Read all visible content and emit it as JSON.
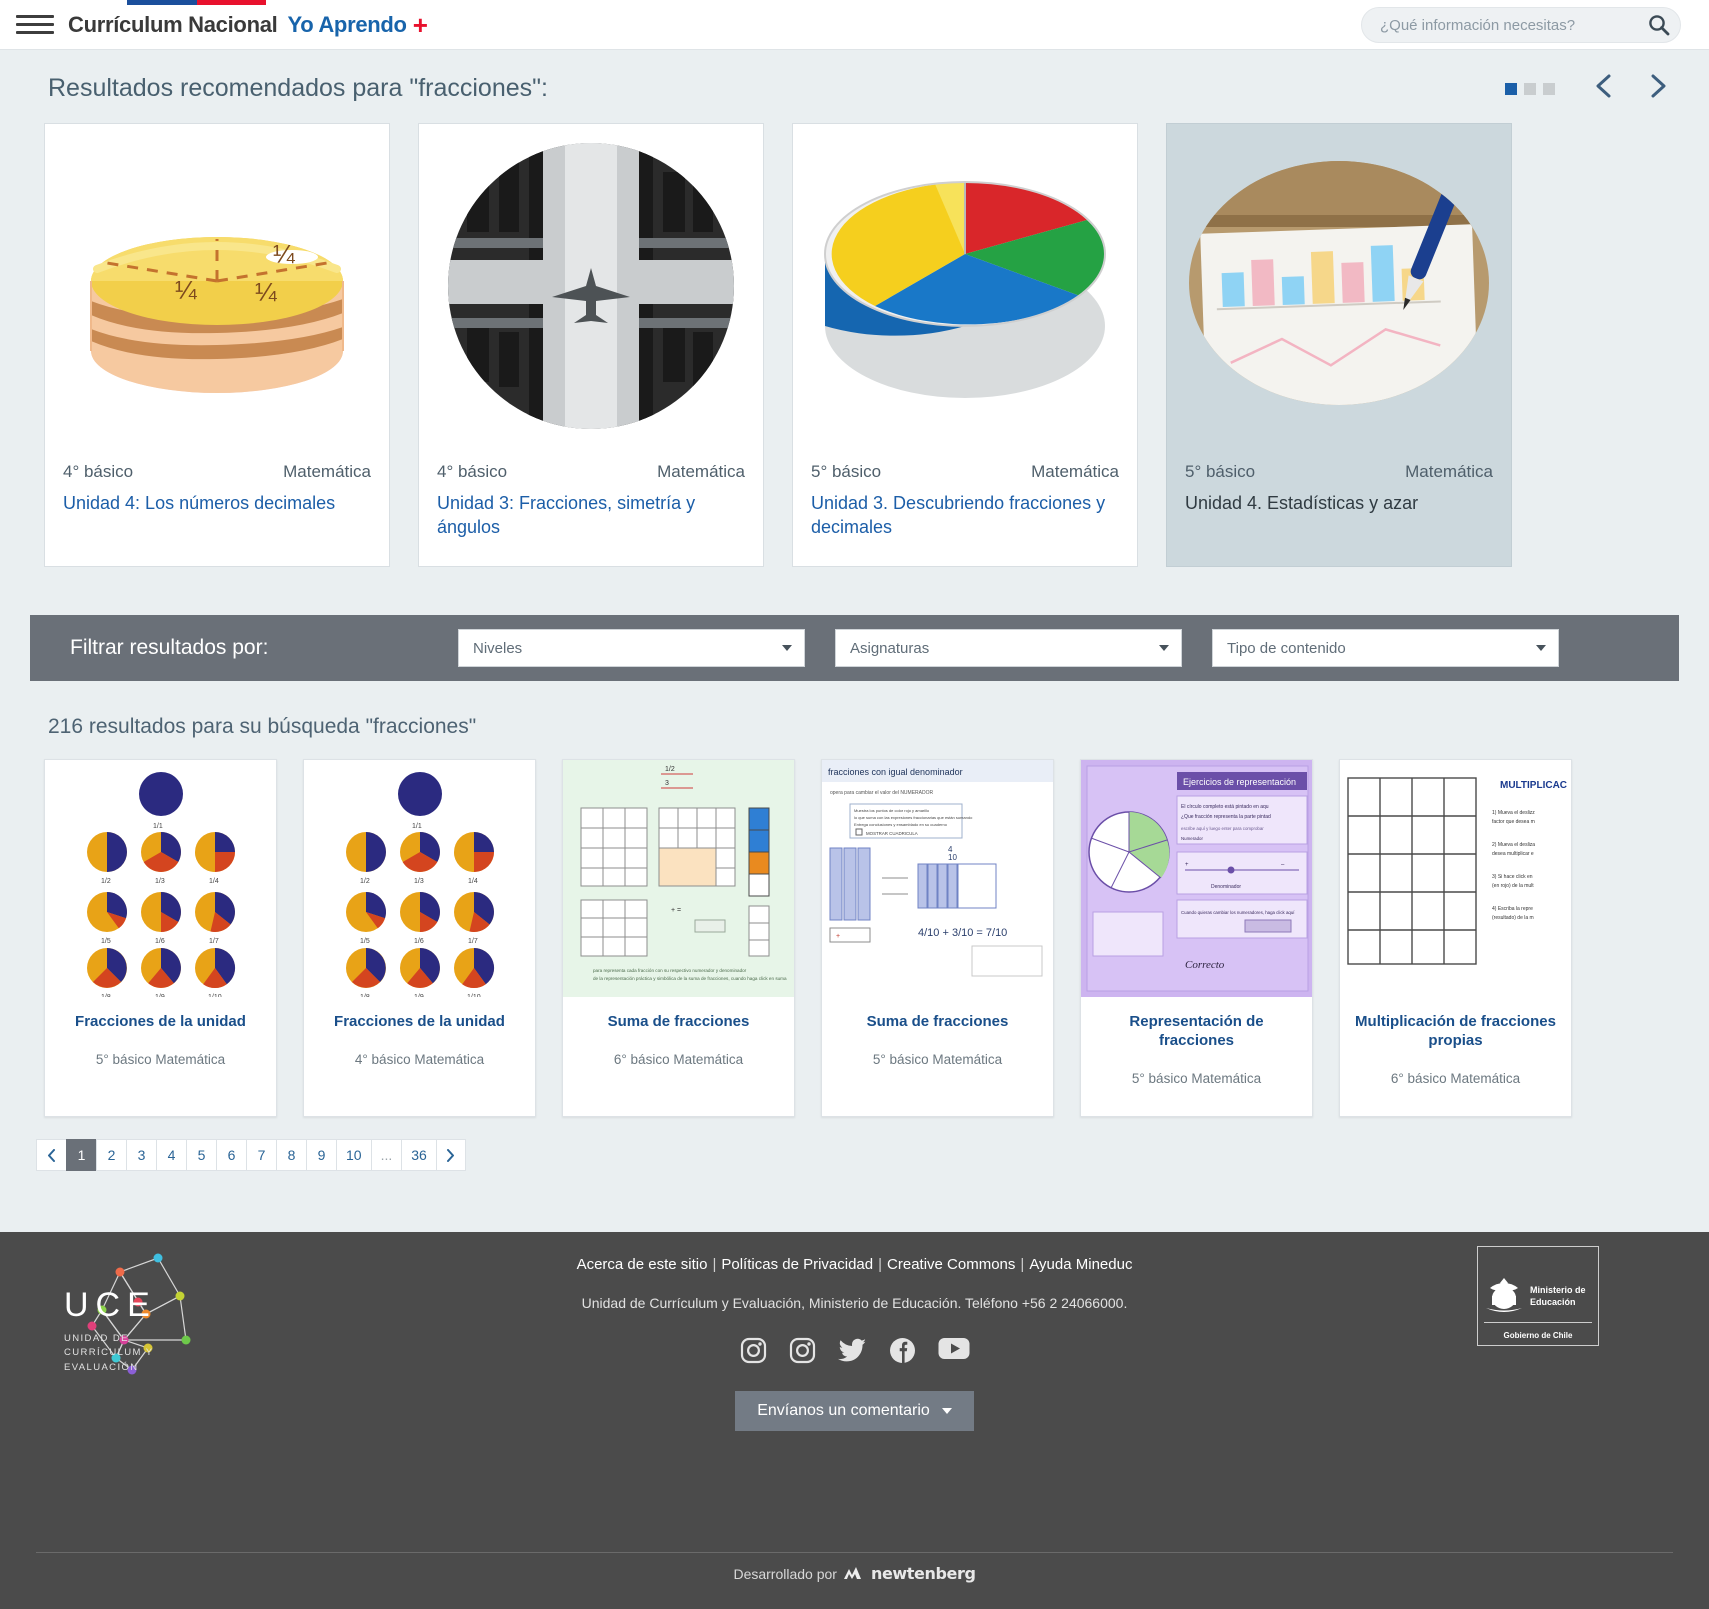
{
  "header": {
    "menu_icon": "hamburger-menu-icon",
    "brand": "Currículum Nacional",
    "brand_sub": "Yo Aprendo",
    "brand_plus": "+",
    "flag_colors": [
      "#ffffff",
      "#1b4f9c",
      "#e8112d"
    ],
    "search": {
      "placeholder": "¿Qué información necesitas?",
      "value": "",
      "icon": "search-icon"
    }
  },
  "recommended": {
    "title": "Resultados recomendados para \"fracciones\":",
    "dots": [
      "on",
      "off",
      "off"
    ],
    "prev_icon": "chevron-left-icon",
    "next_icon": "chevron-right-icon",
    "cards": [
      {
        "level": "4° básico",
        "subject": "Matemática",
        "name": "Unidad 4: Los números decimales",
        "thumb": "cake-fractions-illustration",
        "active": false
      },
      {
        "level": "4° básico",
        "subject": "Matemática",
        "name": "Unidad 3: Fracciones, simetría y ángulos",
        "thumb": "airplane-symmetry-photo",
        "active": false
      },
      {
        "level": "5° básico",
        "subject": "Matemática",
        "name": "Unidad 3. Descubriendo fracciones y decimales",
        "thumb": "colored-pie-blocks-photo",
        "active": false
      },
      {
        "level": "5° básico",
        "subject": "Matemática",
        "name": "Unidad 4. Estadísticas y azar",
        "thumb": "charts-and-pen-photo",
        "active": true
      }
    ]
  },
  "filters": {
    "label": "Filtrar resultados por:",
    "selects": [
      {
        "name": "niveles",
        "value": "Niveles"
      },
      {
        "name": "asignaturas",
        "value": "Asignaturas"
      },
      {
        "name": "tipo-de-contenido",
        "value": "Tipo de contenido"
      }
    ]
  },
  "results": {
    "count_text": "216 resultados para su búsqueda \"fracciones\"",
    "cards": [
      {
        "title": "Fracciones de la unidad",
        "meta": "5° básico Matemática",
        "thumb": "fraction-circles-grid"
      },
      {
        "title": "Fracciones de la unidad",
        "meta": "4° básico Matemática",
        "thumb": "fraction-circles-grid"
      },
      {
        "title": "Suma de fracciones",
        "meta": "6° básico Matemática",
        "thumb": "green-worksheet-grid"
      },
      {
        "title": "Suma de fracciones",
        "meta": "5° básico Matemática",
        "thumb": "denominator-worksheet"
      },
      {
        "title": "Representación de fracciones",
        "meta": "5° básico Matemática",
        "thumb": "purple-exercise-screen"
      },
      {
        "title": "Multiplicación de fracciones propias",
        "meta": "6° básico Matemática",
        "thumb": "multiplication-worksheet"
      }
    ]
  },
  "pagination": {
    "prev_icon": "chevron-left-icon",
    "next_icon": "chevron-right-icon",
    "pages": [
      "1",
      "2",
      "3",
      "4",
      "5",
      "6",
      "7",
      "8",
      "9",
      "10",
      "...",
      "36"
    ],
    "active": "1"
  },
  "footer": {
    "uce_word": "UCE",
    "uce_sub": "UNIDAD DE\nCURRÍCULUM Y\nEVALUACIÓN",
    "links": [
      "Acerca de este sitio",
      "Políticas de Privacidad",
      "Creative Commons",
      "Ayuda Mineduc"
    ],
    "separator": "|",
    "address": "Unidad de Currículum y Evaluación, Ministerio de Educación. Teléfono +56 2 24066000.",
    "social": [
      "instagram-icon",
      "instagram-icon",
      "twitter-icon",
      "facebook-icon",
      "youtube-icon"
    ],
    "comment_button": "Envíanos un comentario",
    "mineduc_line1": "Ministerio de",
    "mineduc_line2": "Educación",
    "mineduc_gob": "Gobierno de Chile",
    "developed_by": "Desarrollado por",
    "developer": "newtenberg"
  }
}
